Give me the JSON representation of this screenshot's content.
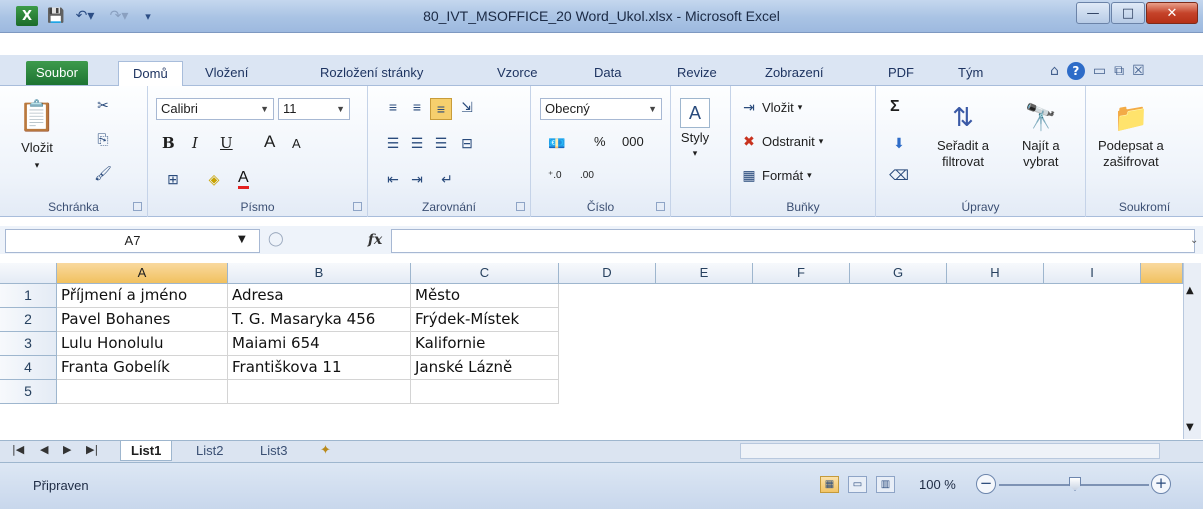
{
  "window": {
    "title": "80_IVT_MSOFFICE_20 Word_Ukol.xlsx  -  Microsoft Excel",
    "logo": "X"
  },
  "tabs": [
    "Soubor",
    "Domů",
    "Vložení",
    "Rozložení stránky",
    "Vzorce",
    "Data",
    "Revize",
    "Zobrazení",
    "PDF",
    "Tým"
  ],
  "ribbon": {
    "clipboard": {
      "paste": "Vložit",
      "label": "Schránka"
    },
    "font": {
      "name": "Calibri",
      "size": "11",
      "bold": "B",
      "italic": "I",
      "underline": "U",
      "grow": "A",
      "shrink": "A",
      "color": "A",
      "label": "Písmo"
    },
    "alignment": {
      "label": "Zarovnání"
    },
    "number": {
      "format": "Obecný",
      "percent": "%",
      "thousands": "000",
      "label": "Číslo"
    },
    "styles": {
      "label_btn": "Styly"
    },
    "cells": {
      "insert": "Vložit",
      "delete": "Odstranit",
      "format": "Formát",
      "label": "Buňky"
    },
    "editing": {
      "sum": "Σ",
      "sort_l1": "Seřadit a",
      "sort_l2": "filtrovat",
      "find_l1": "Najít a",
      "find_l2": "vybrat",
      "label": "Úpravy"
    },
    "privacy": {
      "sign_l1": "Podepsat a",
      "sign_l2": "zašifrovat",
      "label": "Soukromí"
    }
  },
  "formula_bar": {
    "name_box": "A7",
    "fx": "fx",
    "value": ""
  },
  "columns": [
    "A",
    "B",
    "C",
    "D",
    "E",
    "F",
    "G",
    "H",
    "I"
  ],
  "rows": [
    {
      "num": "1",
      "cells": [
        "Příjmení a jméno",
        "Adresa",
        "Město"
      ]
    },
    {
      "num": "2",
      "cells": [
        "Pavel Bohanes",
        "T. G. Masaryka 456",
        "Frýdek-Místek"
      ]
    },
    {
      "num": "3",
      "cells": [
        "Lulu Honolulu",
        "Maiami 654",
        "Kalifornie"
      ]
    },
    {
      "num": "4",
      "cells": [
        "Franta Gobelík",
        "Františkova 11",
        "Janské Lázně"
      ]
    },
    {
      "num": "5",
      "cells": [
        "",
        "",
        ""
      ]
    }
  ],
  "sheets": [
    "List1",
    "List2",
    "List3"
  ],
  "status": {
    "ready": "Připraven",
    "zoom": "100 %"
  },
  "colors": {
    "file_tab": "#1d7432",
    "selection": "#f1c15f",
    "ribbon_bg": "#e3ebf6"
  }
}
